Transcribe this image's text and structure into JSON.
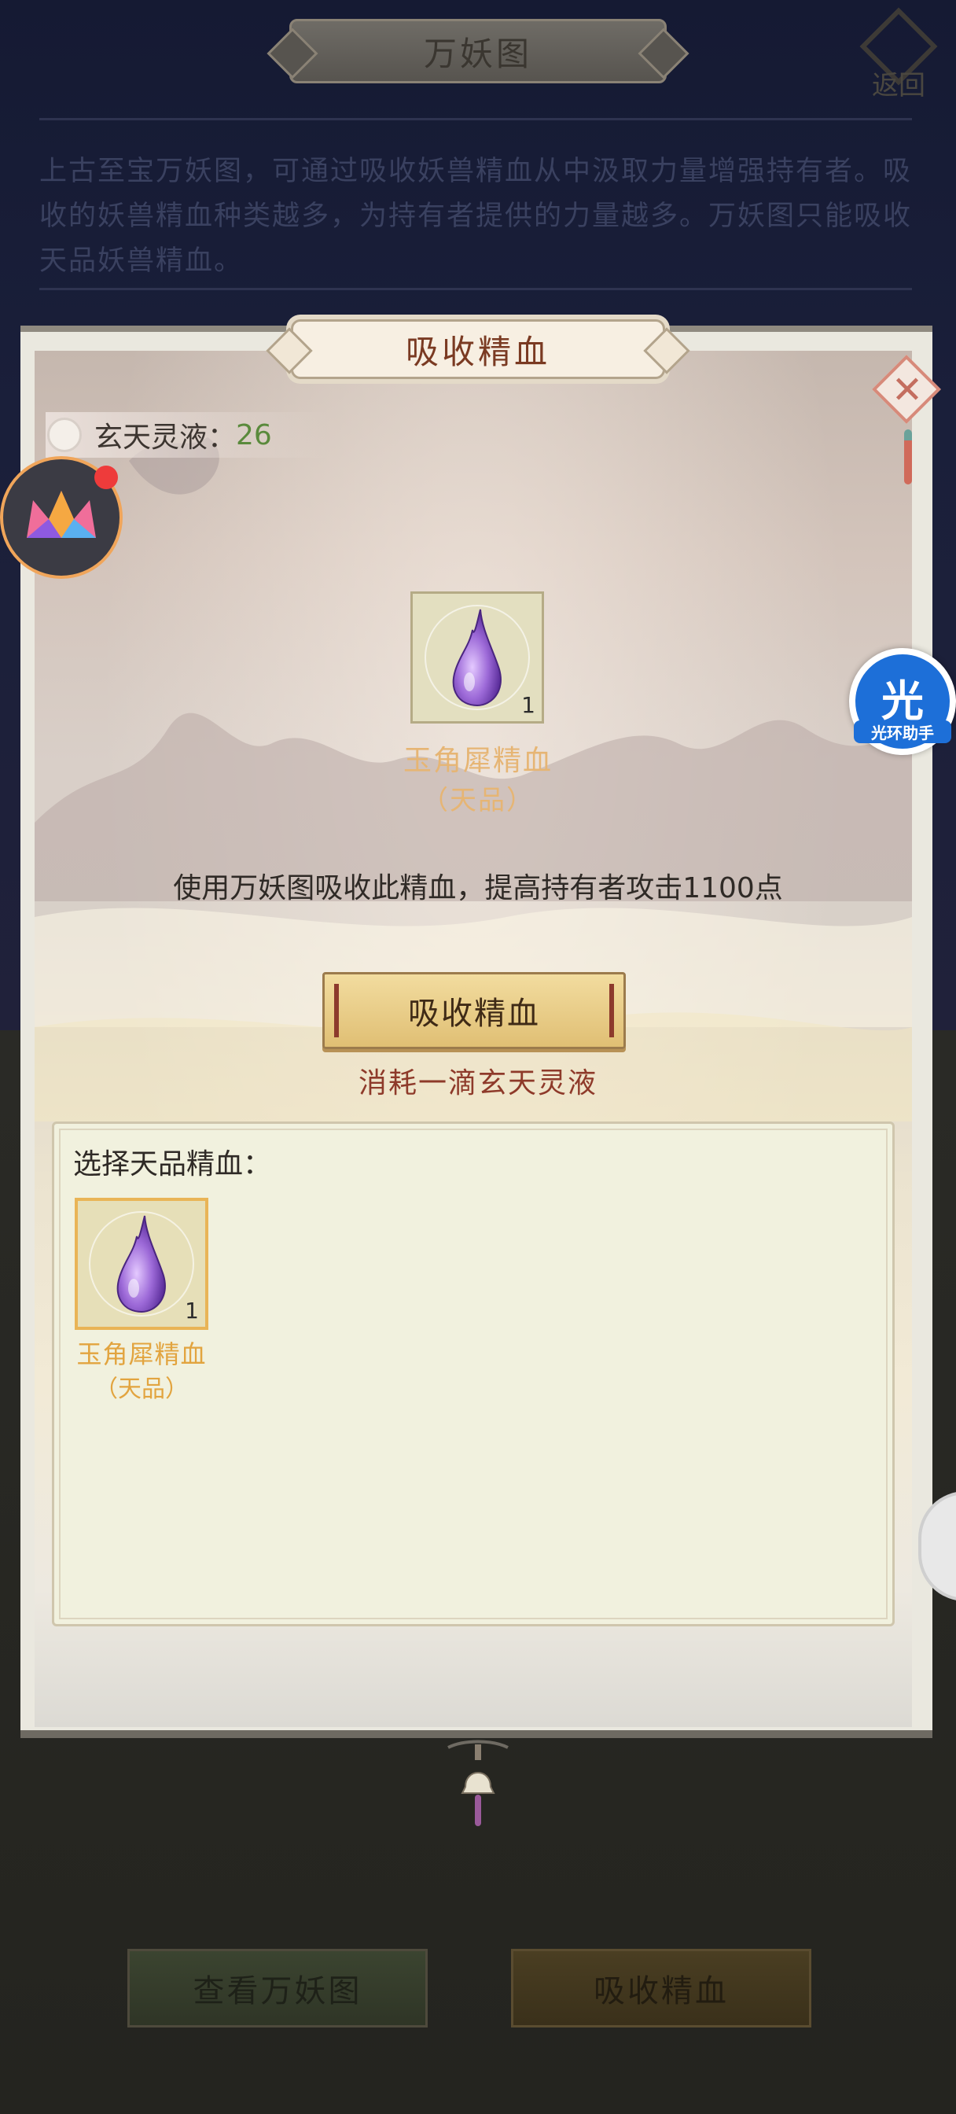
{
  "header": {
    "title": "万妖图",
    "back_label": "返回"
  },
  "intro": {
    "text": "上古至宝万妖图，可通过吸收妖兽精血从中汲取力量增强持有者。吸收的妖兽精血种类越多，为持有者提供的力量越多。万妖图只能吸收天品妖兽精血。"
  },
  "dialog": {
    "title": "吸收精血",
    "resource": {
      "label": "玄天灵液：",
      "value": "26"
    },
    "selected_item": {
      "name": "玉角犀精血",
      "grade": "（天品）",
      "count": "1",
      "icon": "purple-blood-drop-icon"
    },
    "effect_text": "使用万妖图吸收此精血，提高持有者攻击1100点",
    "absorb_button_label": "吸收精血",
    "cost_text": "消耗一滴玄天灵液",
    "selection": {
      "title": "选择天品精血：",
      "items": [
        {
          "name": "玉角犀精血",
          "grade": "（天品）",
          "count": "1",
          "icon": "purple-blood-drop-icon"
        }
      ]
    }
  },
  "bottom_tabs": {
    "view_label": "查看万妖图",
    "absorb_label": "吸收精血"
  },
  "overlays": {
    "helper_glyph": "光",
    "helper_label": "光环助手"
  },
  "colors": {
    "accent_orange": "#e6b574",
    "resource_green": "#5a8a3c",
    "cost_red": "#8e3a2a",
    "title_brown": "#7a3a22"
  }
}
